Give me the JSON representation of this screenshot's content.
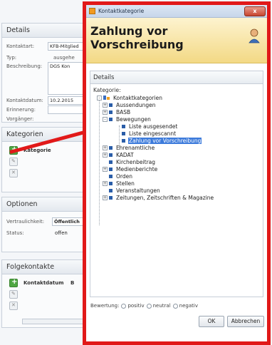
{
  "background": {
    "details": {
      "header": "Details",
      "kontaktart_label": "Kontaktart:",
      "kontaktart_value": "KFB-Mitglied",
      "typ_label": "Typ:",
      "typ_value": "ausgehe",
      "beschreibung_label": "Beschreibung:",
      "beschreibung_value": "DGS Kon",
      "kontaktdatum_label": "Kontaktdatum:",
      "kontaktdatum_value": "10.2.2015",
      "erinnerung_label": "Erinnerung:",
      "vorgaenger_label": "Vorgänger:"
    },
    "kategorien": {
      "header": "Kategorien",
      "column": "Kategorie"
    },
    "optionen": {
      "header": "Optionen",
      "vertraulichkeit_label": "Vertraulichkeit:",
      "vertraulichkeit_value": "Öffentlich",
      "status_label": "Status:",
      "status_value": "offen"
    },
    "folgekontakte": {
      "header": "Folgekontakte",
      "column": "Kontaktdatum",
      "column2": "B"
    }
  },
  "dialog": {
    "window_title": "Kontaktkategorie",
    "close_label": "x",
    "header_title": "Zahlung vor Vorschreibung",
    "details_header": "Details",
    "kategorie_label": "Kategorie:",
    "tree": {
      "root": "Kontaktkategorien",
      "items": [
        {
          "label": "Aussendungen",
          "expander": "+"
        },
        {
          "label": "BASB",
          "expander": "+"
        },
        {
          "label": "Bewegungen",
          "expander": "-"
        },
        {
          "label": "Ehrenamtliche",
          "expander": "+"
        },
        {
          "label": "KADAT",
          "expander": "+"
        },
        {
          "label": "Kirchenbeitrag",
          "expander": ""
        },
        {
          "label": "Medienberichte",
          "expander": "+"
        },
        {
          "label": "Orden",
          "expander": ""
        },
        {
          "label": "Stellen",
          "expander": "+"
        },
        {
          "label": "Veranstaltungen",
          "expander": ""
        },
        {
          "label": "Zeitungen, Zeitschriften & Magazine",
          "expander": "+"
        }
      ],
      "bewegungen_children": [
        {
          "label": "Liste ausgesendet"
        },
        {
          "label": "Liste eingescannt"
        },
        {
          "label": "Zahlung vor Vorschreibung",
          "selected": true
        }
      ]
    },
    "rating": {
      "label": "Bewertung:",
      "options": [
        "positiv",
        "neutral",
        "negativ"
      ]
    },
    "ok_label": "OK",
    "cancel_label": "Abbrechen"
  },
  "colors": {
    "annotation": "#e11919",
    "selection": "#3d7bdb",
    "header_gradient_top": "#fdf3cf",
    "header_gradient_bottom": "#f3d985"
  },
  "icons": {
    "title": "window-icon",
    "header": "person-icon",
    "tree_root": "tree-root-icon"
  }
}
